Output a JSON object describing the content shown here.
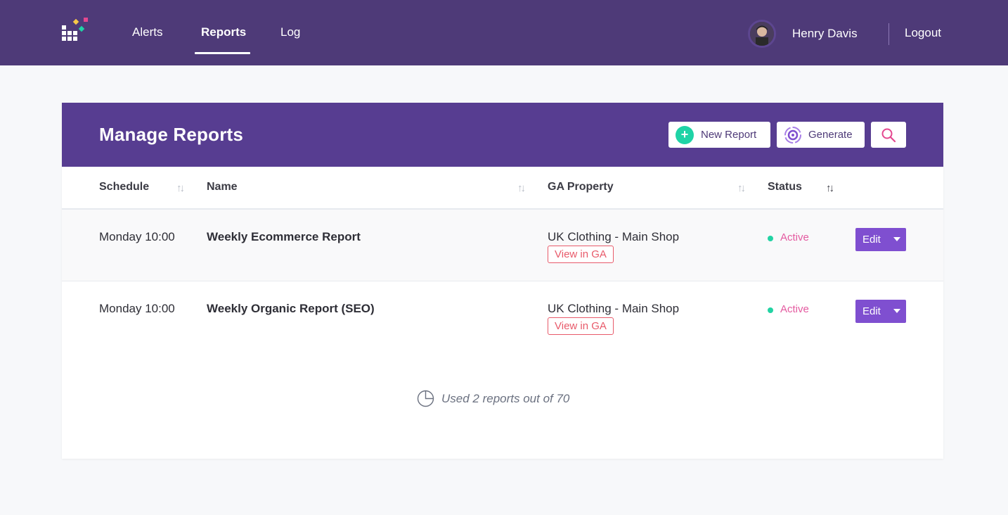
{
  "nav": {
    "links": [
      {
        "label": "Alerts",
        "active": false
      },
      {
        "label": "Reports",
        "active": true
      },
      {
        "label": "Log",
        "active": false
      }
    ],
    "user_name": "Henry Davis",
    "logout_label": "Logout"
  },
  "card": {
    "title": "Manage Reports",
    "new_report_label": "New Report",
    "generate_label": "Generate"
  },
  "table": {
    "headers": {
      "schedule": "Schedule",
      "name": "Name",
      "ga_property": "GA Property",
      "status": "Status"
    },
    "sort_icon": "↑↓",
    "rows": [
      {
        "schedule": "Monday 10:00",
        "name": "Weekly Ecommerce Report",
        "ga_property": "UK Clothing - Main Shop",
        "view_link": "View in GA",
        "status": "Active",
        "action": "Edit"
      },
      {
        "schedule": "Monday 10:00",
        "name": "Weekly Organic Report (SEO)",
        "ga_property": "UK Clothing - Main Shop",
        "view_link": "View in GA",
        "status": "Active",
        "action": "Edit"
      }
    ]
  },
  "usage_text": "Used 2 reports out of 70",
  "colors": {
    "topbar": "#4e3a78",
    "card_header": "#573d91",
    "accent_green": "#1fd3a6",
    "edit_button": "#7f4fd0",
    "link_red": "#e85a6a",
    "status_pink": "#e45aa0"
  },
  "icons": {
    "logo": "brand-logo-icon",
    "plus": "plus-circle-icon",
    "generate": "gear-refresh-icon",
    "search": "search-icon",
    "sort": "sort-arrows-icon",
    "caret": "caret-down-icon",
    "usage": "pie-chart-icon"
  }
}
